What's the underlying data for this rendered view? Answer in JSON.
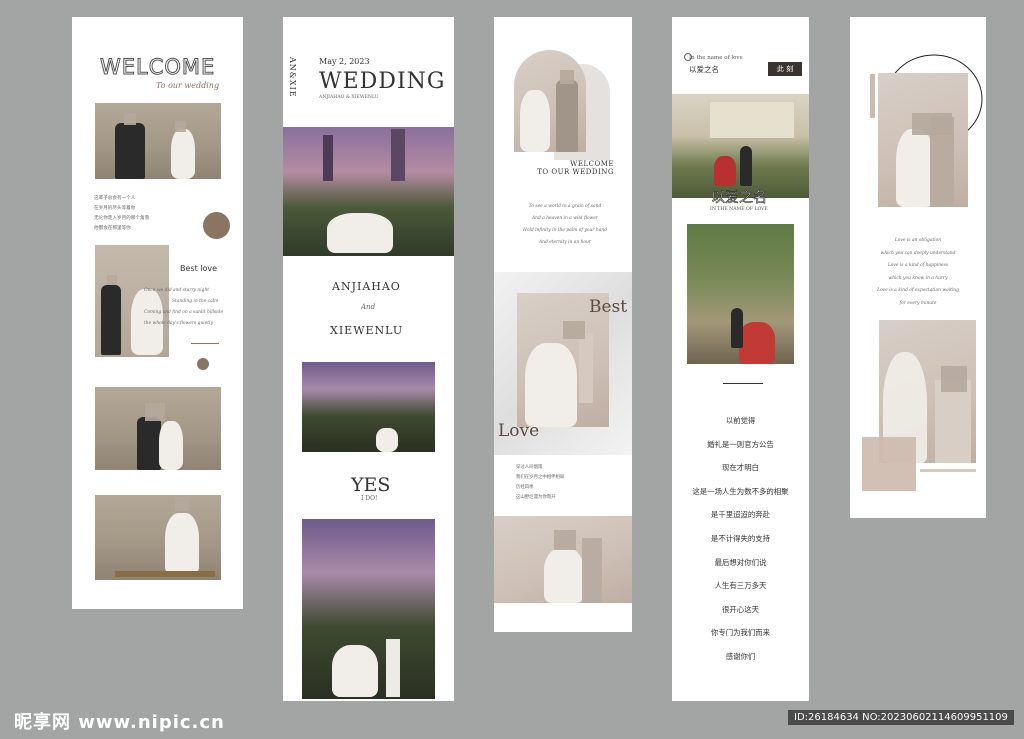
{
  "panel1": {
    "welcome": "WELCOME",
    "subtitle": "To our wedding",
    "cn_lines": [
      "这辈子总会有一个人",
      "在岁月的尽头等着你",
      "无论你走入岁月的哪个角落",
      "他都会在那里等你"
    ],
    "best_love": "Best   love",
    "poem_lines": [
      "Once we did and starry night",
      "Standing in the calm",
      "Coming and find on a sunlit hillside",
      "the whole day's flowers quietly"
    ]
  },
  "panel2": {
    "vertical_names": "AN&XIE",
    "date": "May 2, 2023",
    "wedding": "WEDDING",
    "names_small": "ANJIAHAO & XIEWENLU",
    "name_one": "ANJIAHAO",
    "and": "And",
    "name_two": "XIEWENLU",
    "yes": "YES",
    "ido": "I DO!"
  },
  "panel3": {
    "welcome_lines": [
      "WELCOME",
      "TO OUR WEDDING"
    ],
    "poem_lines": [
      "To see a world in a grain of sand",
      "And a heaven in a wild flower",
      "Hold infinity in the palm of your hand",
      "And eternity in an hour"
    ],
    "best": "Best",
    "love": "Love",
    "cn_lines": [
      "穿过人间烟雨",
      "我们在岁月之中相伴相知",
      "历经四季",
      "这山野烂漫为你而开"
    ]
  },
  "panel4": {
    "in_the_name": "In the name of love",
    "cn_name": "以爱之名",
    "stamp": "此 刻",
    "big_title": "以爱之名",
    "big_subtitle": "IN THE NAME OF LOVE",
    "lines": [
      "以前觉得",
      "婚礼是一则官方公告",
      "现在才明白",
      "这是一场人生为数不多的相聚",
      "是千里迢迢的奔赴",
      "是不计得失的支持",
      "最后想对你们说",
      "人生有三万多天",
      "很开心这天",
      "你专门为我们而来",
      "感谢你们"
    ]
  },
  "panel5": {
    "poem_lines": [
      "Love is an obligation",
      "which you can deeply understand",
      "Love is a kind of happiness",
      "which you know in a hurry",
      "Love is a kind of expectation waiting",
      "for every minute"
    ]
  },
  "footer": {
    "logo": "昵享网 www.nipic.cn",
    "id_text": "ID:26184634 NO:20230602114609951109"
  },
  "colors": {
    "background": "#a3a5a4",
    "accent_brown": "#8b7562",
    "stamp_bg": "#3a3330",
    "text_dark": "#333333"
  }
}
